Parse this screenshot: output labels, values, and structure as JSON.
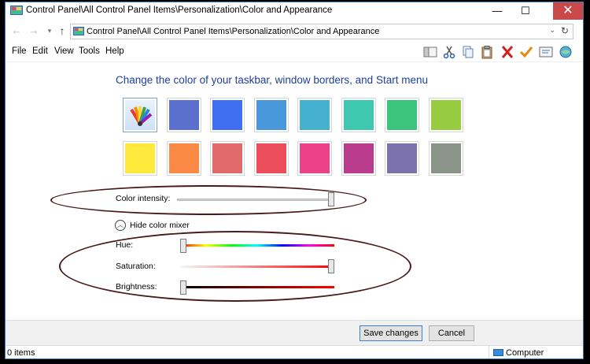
{
  "window": {
    "title": "Control Panel\\All Control Panel Items\\Personalization\\Color and Appearance",
    "minimize_glyph": "—",
    "maximize_glyph": "☐",
    "close_glyph": "✕"
  },
  "address": {
    "back_glyph": "←",
    "forward_glyph": "→",
    "recent_glyph": "▾",
    "up_glyph": "↑",
    "path": "Control Panel\\All Control Panel Items\\Personalization\\Color and Appearance",
    "dropdown_glyph": "⌄",
    "refresh_glyph": "↻"
  },
  "menu": {
    "file": "File",
    "edit": "Edit",
    "view": "View",
    "tools": "Tools",
    "help": "Help"
  },
  "toolbar_icons": [
    "preview-pane-icon",
    "cut-icon",
    "copy-icon",
    "paste-icon",
    "delete-icon",
    "checkmark-icon",
    "properties-icon",
    "globe-icon"
  ],
  "content": {
    "heading": "Change the color of your taskbar, window borders, and Start menu",
    "swatches": [
      {
        "name": "automatic",
        "color": "#ffffff",
        "selected": true
      },
      {
        "name": "slate-blue",
        "color": "#5b6fcf"
      },
      {
        "name": "blue",
        "color": "#3f6ef0"
      },
      {
        "name": "sky-blue",
        "color": "#4a98dc"
      },
      {
        "name": "teal-blue",
        "color": "#45b0d0"
      },
      {
        "name": "turquoise",
        "color": "#3fc8b0"
      },
      {
        "name": "green",
        "color": "#3cc47c"
      },
      {
        "name": "lime",
        "color": "#98cc40"
      },
      {
        "name": "yellow",
        "color": "#fee93c"
      },
      {
        "name": "orange",
        "color": "#fb8a46"
      },
      {
        "name": "salmon",
        "color": "#e36a6a"
      },
      {
        "name": "red",
        "color": "#ec4d5a"
      },
      {
        "name": "pink",
        "color": "#ee4288"
      },
      {
        "name": "magenta",
        "color": "#ba3c8c"
      },
      {
        "name": "purple",
        "color": "#7c72ac"
      },
      {
        "name": "grey-green",
        "color": "#8a9488"
      }
    ],
    "intensity_label": "Color intensity:",
    "intensity_value": 1.0,
    "mixer_toggle_label": "Hide color mixer",
    "mixer_toggle_glyph": "︿",
    "hue_label": "Hue:",
    "hue_value": 0.0,
    "saturation_label": "Saturation:",
    "saturation_value": 1.0,
    "brightness_label": "Brightness:",
    "brightness_value": 0.0
  },
  "buttons": {
    "save": "Save changes",
    "cancel": "Cancel"
  },
  "status": {
    "items": "0 items",
    "location": "Computer"
  },
  "colors": {
    "heading": "#1e3f9a",
    "annotation_oval": "#4a1a1a",
    "close_button": "#c94848"
  }
}
